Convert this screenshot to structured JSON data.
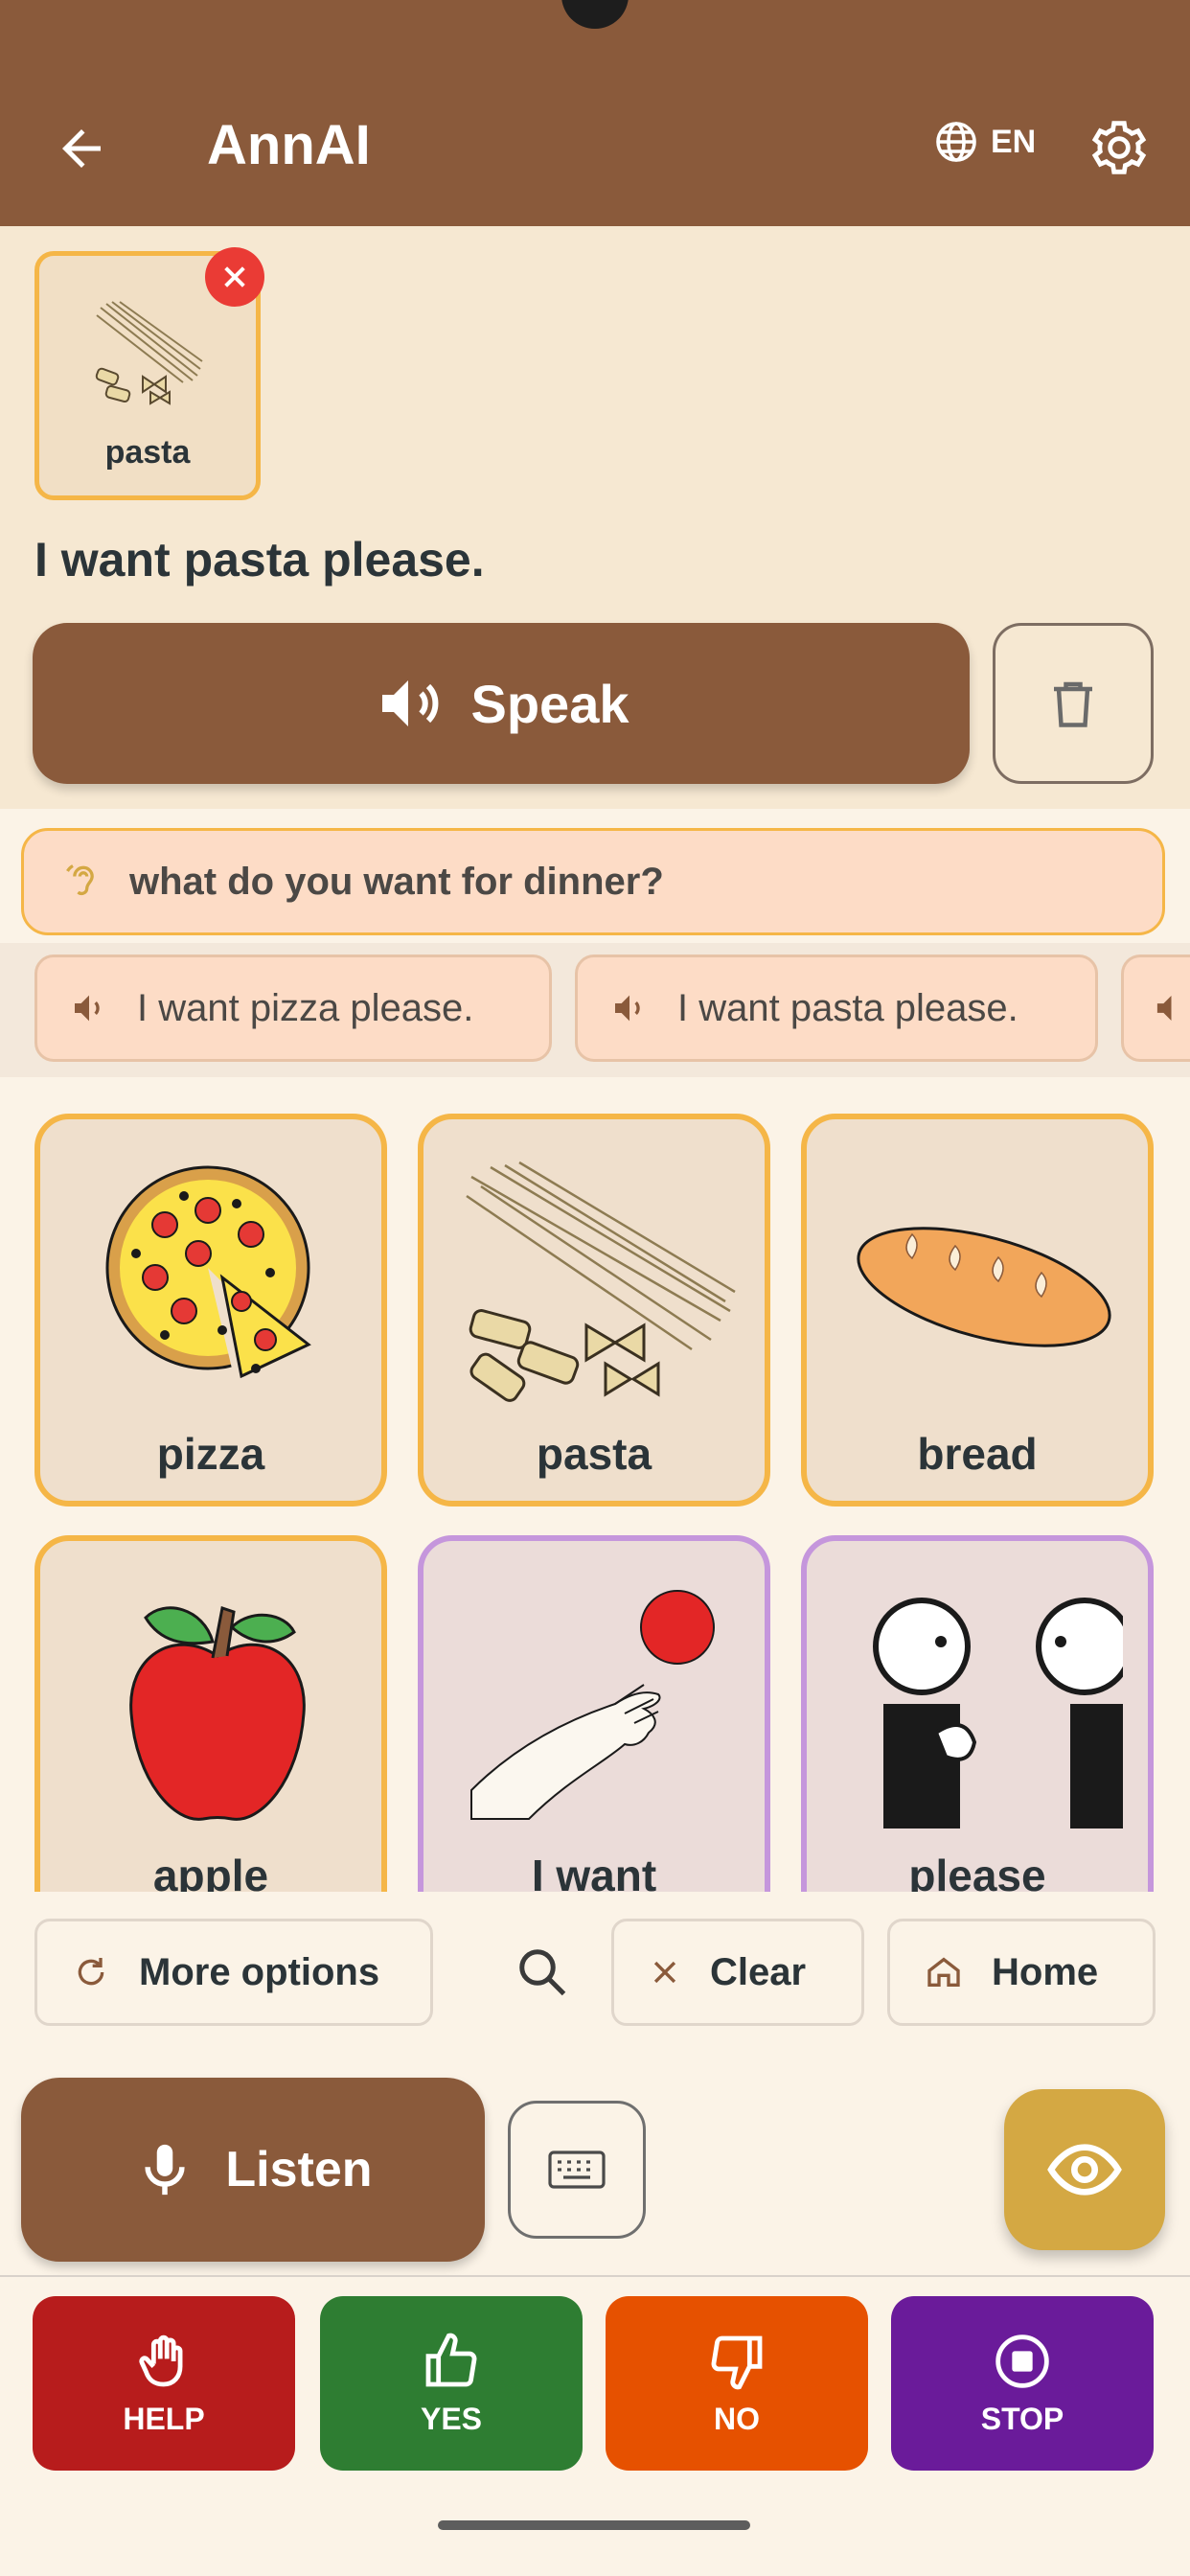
{
  "app": {
    "title": "AnnAI",
    "language": "EN",
    "colors": {
      "brand": "#8a5a3b",
      "food_border": "#f5b647",
      "phrase_border": "#c596dc",
      "accent_eye": "#d4a843"
    }
  },
  "sentence": {
    "chips": [
      {
        "label": "pasta",
        "icon": "pasta-symbol"
      }
    ],
    "text": "I want pasta please.",
    "speak_label": "Speak"
  },
  "heard": {
    "text": "what do you want for dinner?",
    "icon": "ear-icon"
  },
  "suggestions": [
    {
      "text": "I want pizza please."
    },
    {
      "text": "I want pasta please."
    }
  ],
  "tiles": [
    {
      "label": "pizza",
      "category": "food"
    },
    {
      "label": "pasta",
      "category": "food"
    },
    {
      "label": "bread",
      "category": "food"
    },
    {
      "label": "apple",
      "category": "food"
    },
    {
      "label": "I want",
      "category": "phrase"
    },
    {
      "label": "please",
      "category": "phrase"
    }
  ],
  "controls": {
    "more_options": "More options",
    "clear": "Clear",
    "home": "Home",
    "listen": "Listen"
  },
  "quick": [
    {
      "label": "HELP",
      "color": "#b71c1c",
      "icon": "hand-icon"
    },
    {
      "label": "YES",
      "color": "#2e7d32",
      "icon": "thumbs-up-icon"
    },
    {
      "label": "NO",
      "color": "#e65100",
      "icon": "thumbs-down-icon"
    },
    {
      "label": "STOP",
      "color": "#6a1b9a",
      "icon": "stop-icon"
    }
  ]
}
